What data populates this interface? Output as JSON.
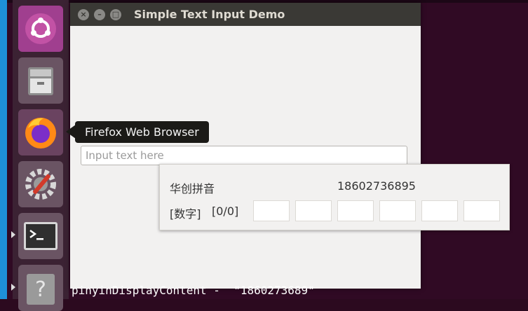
{
  "window": {
    "title": "Simple Text Input Demo",
    "buttons": {
      "close": "×",
      "minimize": "–",
      "maximize": "□"
    }
  },
  "text_input": {
    "placeholder": "Input text here",
    "value": ""
  },
  "tooltip": {
    "text": "Firefox Web Browser"
  },
  "ime_popup": {
    "title": "华创拼音",
    "phone": "18602736895",
    "mode": "[数字]",
    "page": "[0/0]",
    "candidates": [
      "",
      "",
      "",
      "",
      "",
      ""
    ]
  },
  "terminal": {
    "line": "pinyinDisplayContent -  \"1860273689\""
  },
  "launcher": {
    "items": [
      {
        "name": "ubuntu-software"
      },
      {
        "name": "files"
      },
      {
        "name": "firefox"
      },
      {
        "name": "settings"
      },
      {
        "name": "terminal"
      },
      {
        "name": "help"
      }
    ]
  },
  "colors": {
    "desktop": "#300a24",
    "titlebar": "#3a3935",
    "window": "#f2f1f0",
    "accent": "#1e8fd8"
  }
}
